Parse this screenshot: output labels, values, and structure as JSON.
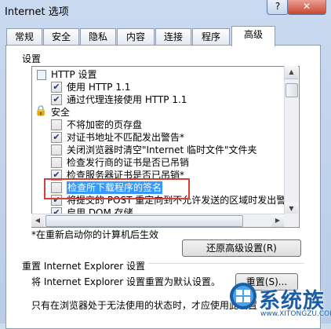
{
  "window": {
    "title": "Internet 选项",
    "help": "?",
    "close": "✕"
  },
  "tabs": [
    "常规",
    "安全",
    "隐私",
    "内容",
    "连接",
    "程序",
    "高级"
  ],
  "settings": {
    "group_label": "设置",
    "items": [
      {
        "kind": "category",
        "label": "HTTP 设置",
        "icon": "folder-icon"
      },
      {
        "kind": "checkbox",
        "checked": true,
        "label": "使用 HTTP 1.1"
      },
      {
        "kind": "checkbox",
        "checked": true,
        "label": "通过代理连接使用 HTTP 1.1"
      },
      {
        "kind": "category",
        "label": "安全",
        "icon": "lock-icon"
      },
      {
        "kind": "checkbox",
        "checked": false,
        "label": "不将加密的页存盘"
      },
      {
        "kind": "checkbox",
        "checked": true,
        "label": "对证书地址不匹配发出警告*"
      },
      {
        "kind": "checkbox",
        "checked": false,
        "label": "关闭浏览器时清空\"Internet 临时文件\"文件夹"
      },
      {
        "kind": "checkbox",
        "checked": false,
        "label": "检查发行商的证书是否已吊销"
      },
      {
        "kind": "checkbox",
        "checked": true,
        "label": "检查服务器证书是否已吊销*"
      },
      {
        "kind": "checkbox",
        "checked": false,
        "label": "检查所下载程序的签名",
        "selected": true
      },
      {
        "kind": "checkbox",
        "checked": true,
        "label": "将提交的 POST 重定向到不允许发送的区域时发出警"
      },
      {
        "kind": "checkbox",
        "checked": true,
        "label": "启用 DOM 存储"
      }
    ]
  },
  "restart_note": "*在重新启动你的计算机后生效",
  "restore_button": "还原高级设置(R)",
  "reset": {
    "title": "重置 Internet Explorer 设置",
    "description": "将 Internet Explorer 设置重置为默认设置。",
    "button": "重置(S)...",
    "bottom_text": "只有在浏览器处于无法使用的状态时，才应使用此设置"
  },
  "watermark": {
    "text": "系统族",
    "url": "www.XITONGZU.COM"
  },
  "colors": {
    "selection": "#3399ff",
    "annotation_box": "#d8403a",
    "watermark": "#1b5ea8"
  }
}
